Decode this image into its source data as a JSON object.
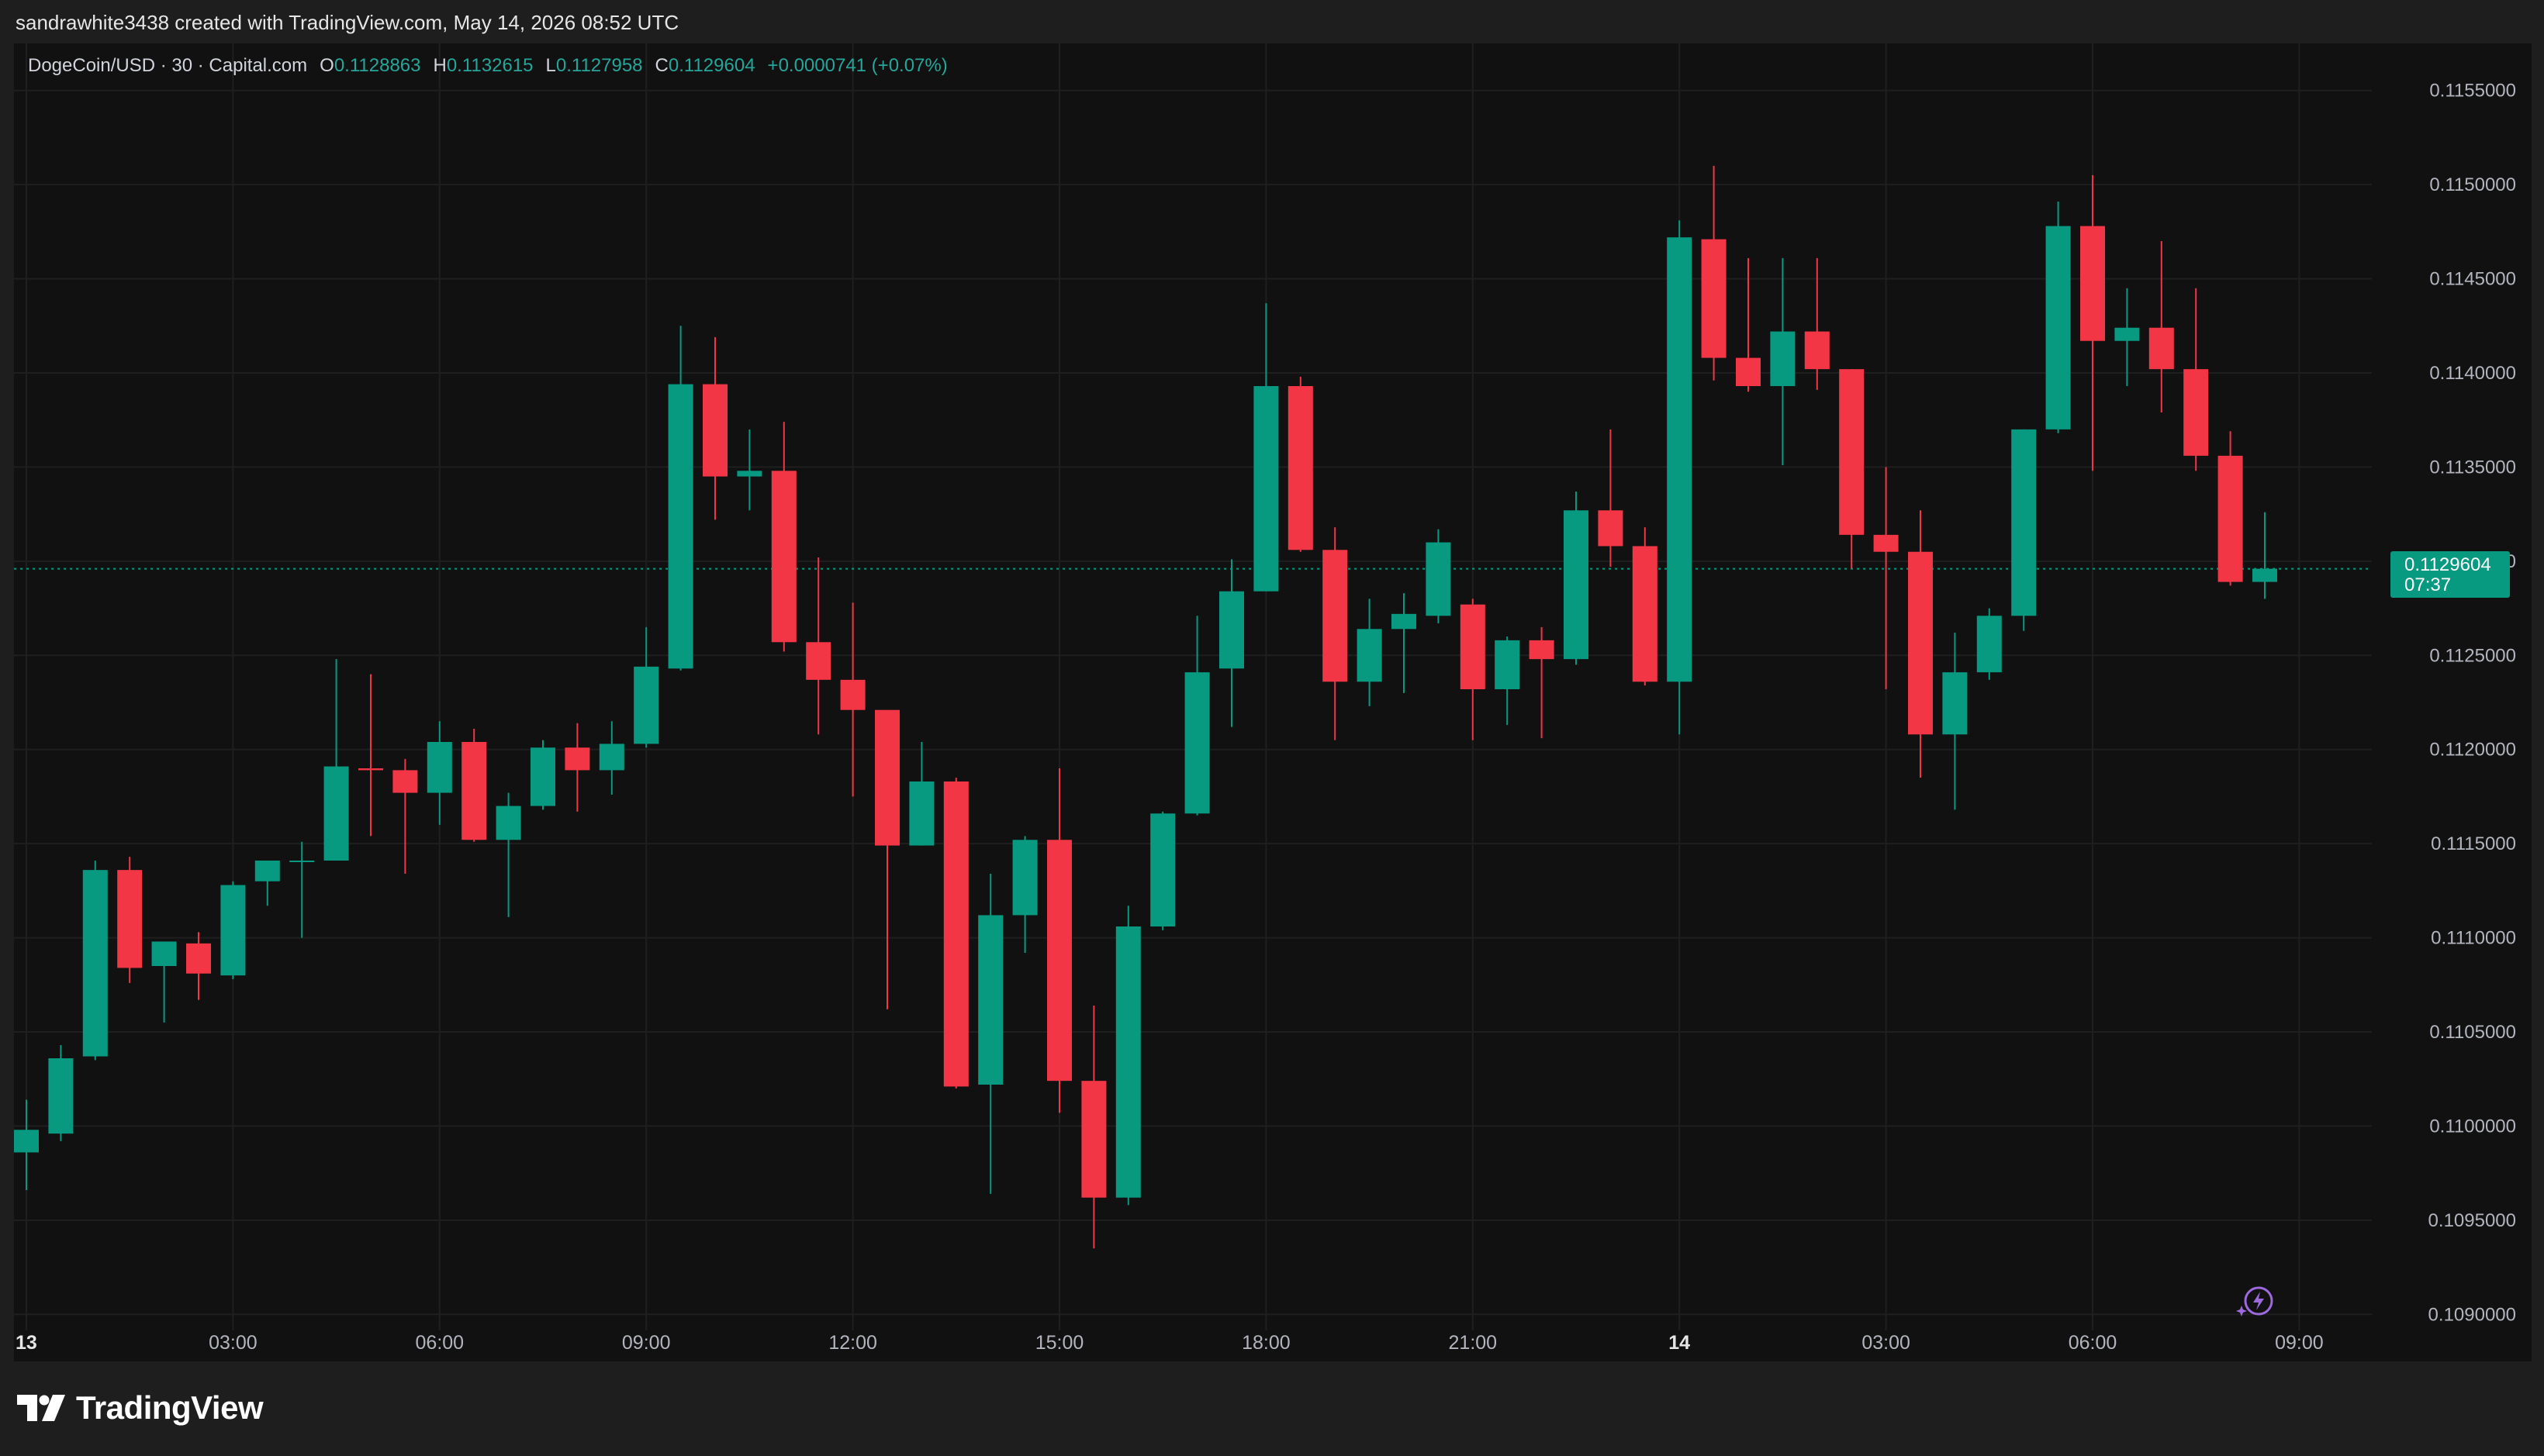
{
  "header": {
    "credit": "sandrawhite3438 created with TradingView.com, May 14, 2026 08:52 UTC"
  },
  "legend": {
    "symbol": "DogeCoin/USD · 30 · Capital.com",
    "open_label": "O",
    "open": "0.1128863",
    "high_label": "H",
    "high": "0.1132615",
    "low_label": "L",
    "low": "0.1127958",
    "close_label": "C",
    "close": "0.1129604",
    "change": "+0.0000741 (+0.07%)"
  },
  "last_price": {
    "value": "0.1129604",
    "countdown": "07:37"
  },
  "brand": {
    "name": "TradingView"
  },
  "colors": {
    "up": "#089981",
    "down": "#f23645",
    "background": "#111111",
    "grid": "#1f1f1f",
    "axis_text": "#b2b5be",
    "price_line": "#089981"
  },
  "chart_data": {
    "type": "candlestick",
    "title": "DogeCoin/USD · 30 · Capital.com",
    "interval_minutes": 30,
    "ylim": [
      0.10875,
      0.11575
    ],
    "y_ticks": [
      "0.1090000",
      "0.1095000",
      "0.1100000",
      "0.1105000",
      "0.1110000",
      "0.1115000",
      "0.1120000",
      "0.1125000",
      "0.1130000",
      "0.1135000",
      "0.1140000",
      "0.1145000",
      "0.1150000",
      "0.1155000"
    ],
    "x_ticks": [
      {
        "label": "13",
        "time": "May 13 00:00",
        "bold": true
      },
      {
        "label": "03:00",
        "time": "May 13 03:00"
      },
      {
        "label": "06:00",
        "time": "May 13 06:00"
      },
      {
        "label": "09:00",
        "time": "May 13 09:00"
      },
      {
        "label": "12:00",
        "time": "May 13 12:00"
      },
      {
        "label": "15:00",
        "time": "May 13 15:00"
      },
      {
        "label": "18:00",
        "time": "May 13 18:00"
      },
      {
        "label": "21:00",
        "time": "May 13 21:00"
      },
      {
        "label": "14",
        "time": "May 14 00:00",
        "bold": true
      },
      {
        "label": "03:00",
        "time": "May 14 03:00"
      },
      {
        "label": "06:00",
        "time": "May 14 06:00"
      },
      {
        "label": "09:00",
        "time": "May 14 09:00"
      }
    ],
    "candles": [
      {
        "t": "May 13 00:00",
        "o": 0.10986,
        "h": 0.11014,
        "l": 0.10966,
        "c": 0.10998
      },
      {
        "t": "May 13 00:30",
        "o": 0.10996,
        "h": 0.11043,
        "l": 0.10992,
        "c": 0.11036
      },
      {
        "t": "May 13 01:00",
        "o": 0.11037,
        "h": 0.11141,
        "l": 0.11035,
        "c": 0.11136
      },
      {
        "t": "May 13 01:30",
        "o": 0.11136,
        "h": 0.11143,
        "l": 0.11076,
        "c": 0.11084
      },
      {
        "t": "May 13 02:00",
        "o": 0.11085,
        "h": 0.11097,
        "l": 0.11055,
        "c": 0.11098
      },
      {
        "t": "May 13 02:30",
        "o": 0.11097,
        "h": 0.11103,
        "l": 0.11067,
        "c": 0.11081
      },
      {
        "t": "May 13 03:00",
        "o": 0.1108,
        "h": 0.1113,
        "l": 0.11078,
        "c": 0.11128
      },
      {
        "t": "May 13 03:30",
        "o": 0.1113,
        "h": 0.11141,
        "l": 0.11117,
        "c": 0.11141
      },
      {
        "t": "May 13 04:00",
        "o": 0.11141,
        "h": 0.11151,
        "l": 0.111,
        "c": 0.11141
      },
      {
        "t": "May 13 04:30",
        "o": 0.11141,
        "h": 0.11248,
        "l": 0.11141,
        "c": 0.11191
      },
      {
        "t": "May 13 05:00",
        "o": 0.1119,
        "h": 0.1124,
        "l": 0.11154,
        "c": 0.11189
      },
      {
        "t": "May 13 05:30",
        "o": 0.11189,
        "h": 0.11195,
        "l": 0.11134,
        "c": 0.11177
      },
      {
        "t": "May 13 06:00",
        "o": 0.11177,
        "h": 0.11215,
        "l": 0.1116,
        "c": 0.11204
      },
      {
        "t": "May 13 06:30",
        "o": 0.11204,
        "h": 0.11211,
        "l": 0.11151,
        "c": 0.11152
      },
      {
        "t": "May 13 07:00",
        "o": 0.11152,
        "h": 0.11177,
        "l": 0.11111,
        "c": 0.1117
      },
      {
        "t": "May 13 07:30",
        "o": 0.1117,
        "h": 0.11205,
        "l": 0.11168,
        "c": 0.11201
      },
      {
        "t": "May 13 08:00",
        "o": 0.11201,
        "h": 0.11214,
        "l": 0.11167,
        "c": 0.11189
      },
      {
        "t": "May 13 08:30",
        "o": 0.11189,
        "h": 0.11215,
        "l": 0.11176,
        "c": 0.11203
      },
      {
        "t": "May 13 09:00",
        "o": 0.11203,
        "h": 0.11265,
        "l": 0.11201,
        "c": 0.11244
      },
      {
        "t": "May 13 09:30",
        "o": 0.11243,
        "h": 0.11425,
        "l": 0.11242,
        "c": 0.11394
      },
      {
        "t": "May 13 10:00",
        "o": 0.11394,
        "h": 0.11419,
        "l": 0.11322,
        "c": 0.11345
      },
      {
        "t": "May 13 10:30",
        "o": 0.11345,
        "h": 0.1137,
        "l": 0.11327,
        "c": 0.11348
      },
      {
        "t": "May 13 11:00",
        "o": 0.11348,
        "h": 0.11374,
        "l": 0.11252,
        "c": 0.11257
      },
      {
        "t": "May 13 11:30",
        "o": 0.11257,
        "h": 0.11302,
        "l": 0.11208,
        "c": 0.11237
      },
      {
        "t": "May 13 12:00",
        "o": 0.11237,
        "h": 0.11278,
        "l": 0.11175,
        "c": 0.11221
      },
      {
        "t": "May 13 12:30",
        "o": 0.11221,
        "h": 0.11221,
        "l": 0.11062,
        "c": 0.11149
      },
      {
        "t": "May 13 13:00",
        "o": 0.11149,
        "h": 0.11204,
        "l": 0.11149,
        "c": 0.11183
      },
      {
        "t": "May 13 13:30",
        "o": 0.11183,
        "h": 0.11185,
        "l": 0.1102,
        "c": 0.11021
      },
      {
        "t": "May 13 14:00",
        "o": 0.11022,
        "h": 0.11134,
        "l": 0.10964,
        "c": 0.11112
      },
      {
        "t": "May 13 14:30",
        "o": 0.11112,
        "h": 0.11154,
        "l": 0.11092,
        "c": 0.11152
      },
      {
        "t": "May 13 15:00",
        "o": 0.11152,
        "h": 0.1119,
        "l": 0.11007,
        "c": 0.11024
      },
      {
        "t": "May 13 15:30",
        "o": 0.11024,
        "h": 0.11064,
        "l": 0.10935,
        "c": 0.10962
      },
      {
        "t": "May 13 16:00",
        "o": 0.10962,
        "h": 0.11117,
        "l": 0.10958,
        "c": 0.11106
      },
      {
        "t": "May 13 16:30",
        "o": 0.11106,
        "h": 0.11167,
        "l": 0.11104,
        "c": 0.11166
      },
      {
        "t": "May 13 17:00",
        "o": 0.11166,
        "h": 0.11271,
        "l": 0.11165,
        "c": 0.11241
      },
      {
        "t": "May 13 17:30",
        "o": 0.11243,
        "h": 0.11301,
        "l": 0.11212,
        "c": 0.11284
      },
      {
        "t": "May 13 18:00",
        "o": 0.11284,
        "h": 0.11437,
        "l": 0.11284,
        "c": 0.11393
      },
      {
        "t": "May 13 18:30",
        "o": 0.11393,
        "h": 0.11398,
        "l": 0.11305,
        "c": 0.11306
      },
      {
        "t": "May 13 19:00",
        "o": 0.11306,
        "h": 0.11318,
        "l": 0.11205,
        "c": 0.11236
      },
      {
        "t": "May 13 19:30",
        "o": 0.11236,
        "h": 0.1128,
        "l": 0.11223,
        "c": 0.11264
      },
      {
        "t": "May 13 20:00",
        "o": 0.11264,
        "h": 0.11283,
        "l": 0.1123,
        "c": 0.11272
      },
      {
        "t": "May 13 20:30",
        "o": 0.11271,
        "h": 0.11317,
        "l": 0.11267,
        "c": 0.1131
      },
      {
        "t": "May 13 21:00",
        "o": 0.11277,
        "h": 0.1128,
        "l": 0.11205,
        "c": 0.11232
      },
      {
        "t": "May 13 21:30",
        "o": 0.11232,
        "h": 0.1126,
        "l": 0.11213,
        "c": 0.11258
      },
      {
        "t": "May 13 22:00",
        "o": 0.11258,
        "h": 0.11265,
        "l": 0.11206,
        "c": 0.11248
      },
      {
        "t": "May 13 22:30",
        "o": 0.11248,
        "h": 0.11337,
        "l": 0.11245,
        "c": 0.11327
      },
      {
        "t": "May 13 23:00",
        "o": 0.11327,
        "h": 0.1137,
        "l": 0.11297,
        "c": 0.11308
      },
      {
        "t": "May 13 23:30",
        "o": 0.11308,
        "h": 0.11318,
        "l": 0.11234,
        "c": 0.11236
      },
      {
        "t": "May 14 00:00",
        "o": 0.11236,
        "h": 0.11481,
        "l": 0.11208,
        "c": 0.11472
      },
      {
        "t": "May 14 00:30",
        "o": 0.11471,
        "h": 0.1151,
        "l": 0.11396,
        "c": 0.11408
      },
      {
        "t": "May 14 01:00",
        "o": 0.11408,
        "h": 0.11461,
        "l": 0.1139,
        "c": 0.11393
      },
      {
        "t": "May 14 01:30",
        "o": 0.11393,
        "h": 0.11461,
        "l": 0.11351,
        "c": 0.11422
      },
      {
        "t": "May 14 02:00",
        "o": 0.11422,
        "h": 0.11461,
        "l": 0.11391,
        "c": 0.11402
      },
      {
        "t": "May 14 02:30",
        "o": 0.11402,
        "h": 0.11402,
        "l": 0.11296,
        "c": 0.11314
      },
      {
        "t": "May 14 03:00",
        "o": 0.11314,
        "h": 0.1135,
        "l": 0.11232,
        "c": 0.11305
      },
      {
        "t": "May 14 03:30",
        "o": 0.11305,
        "h": 0.11327,
        "l": 0.11185,
        "c": 0.11208
      },
      {
        "t": "May 14 04:00",
        "o": 0.11208,
        "h": 0.11262,
        "l": 0.11168,
        "c": 0.11241
      },
      {
        "t": "May 14 04:30",
        "o": 0.11241,
        "h": 0.11275,
        "l": 0.11237,
        "c": 0.11271
      },
      {
        "t": "May 14 05:00",
        "o": 0.11271,
        "h": 0.1137,
        "l": 0.11263,
        "c": 0.1137
      },
      {
        "t": "May 14 05:30",
        "o": 0.1137,
        "h": 0.11491,
        "l": 0.11368,
        "c": 0.11478
      },
      {
        "t": "May 14 06:00",
        "o": 0.11478,
        "h": 0.11505,
        "l": 0.11348,
        "c": 0.11417
      },
      {
        "t": "May 14 06:30",
        "o": 0.11417,
        "h": 0.11445,
        "l": 0.11393,
        "c": 0.11424
      },
      {
        "t": "May 14 07:00",
        "o": 0.11424,
        "h": 0.1147,
        "l": 0.11379,
        "c": 0.11402
      },
      {
        "t": "May 14 07:30",
        "o": 0.11402,
        "h": 0.11445,
        "l": 0.11348,
        "c": 0.11356
      },
      {
        "t": "May 14 08:00",
        "o": 0.11356,
        "h": 0.11369,
        "l": 0.11287,
        "c": 0.11289
      },
      {
        "t": "May 14 08:30",
        "o": 0.11289,
        "h": 0.11326,
        "l": 0.1128,
        "c": 0.11296
      }
    ]
  }
}
